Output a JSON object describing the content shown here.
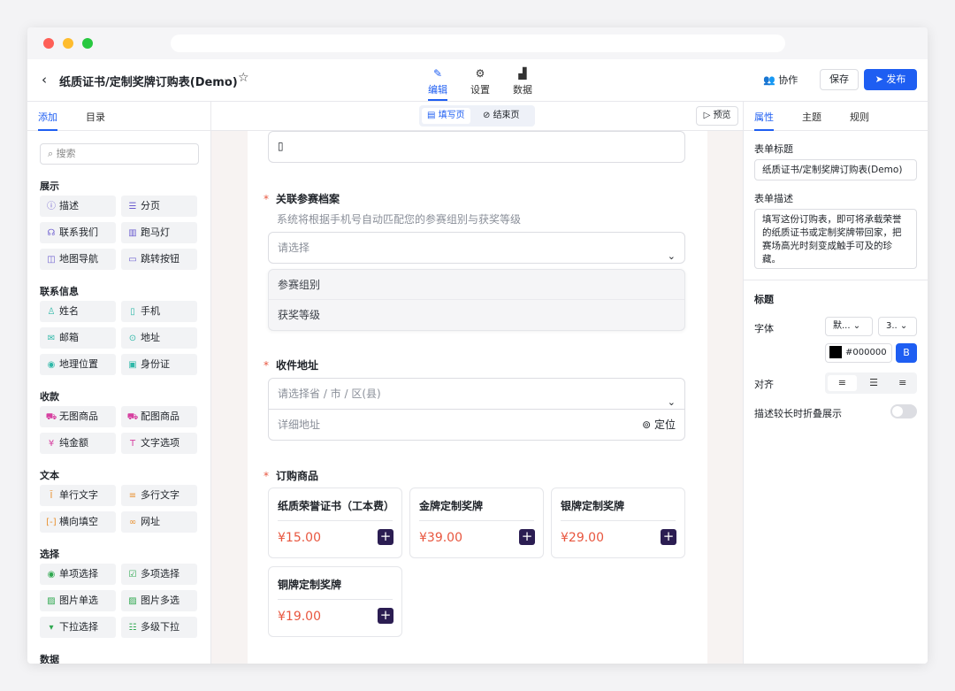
{
  "header": {
    "title": "纸质证书/定制奖牌订购表(Demo)",
    "nav_tabs": [
      {
        "label": "编辑",
        "icon": "pencil-icon"
      },
      {
        "label": "设置",
        "icon": "gear-icon"
      },
      {
        "label": "数据",
        "icon": "chart-icon"
      }
    ],
    "collab_label": "协作",
    "save_label": "保存",
    "publish_label": "发布"
  },
  "left_panel": {
    "tabs": [
      "添加",
      "目录"
    ],
    "search_placeholder": "搜索",
    "groups": [
      {
        "title": "展示",
        "items": [
          "描述",
          "分页",
          "联系我们",
          "跑马灯",
          "地图导航",
          "跳转按钮"
        ]
      },
      {
        "title": "联系信息",
        "items": [
          "姓名",
          "手机",
          "邮箱",
          "地址",
          "地理位置",
          "身份证"
        ]
      },
      {
        "title": "收款",
        "items": [
          "无图商品",
          "配图商品",
          "纯金额",
          "文字选项"
        ]
      },
      {
        "title": "文本",
        "items": [
          "单行文字",
          "多行文字",
          "横向填空",
          "网址"
        ]
      },
      {
        "title": "选择",
        "items": [
          "单项选择",
          "多项选择",
          "图片单选",
          "图片多选",
          "下拉选择",
          "多级下拉"
        ]
      },
      {
        "title": "数据",
        "items": []
      }
    ]
  },
  "canvas": {
    "page_switch": [
      "填写页",
      "结束页"
    ],
    "preview_label": "预览",
    "fields": {
      "archive": {
        "title": "关联参赛档案",
        "description": "系统将根据手机号自动匹配您的参赛组别与获奖等级",
        "placeholder": "请选择",
        "options": [
          "参赛组别",
          "获奖等级"
        ]
      },
      "address": {
        "title": "收件地址",
        "region_placeholder": "请选择省 / 市 / 区(县)",
        "detail_placeholder": "详细地址",
        "locate_label": "定位"
      },
      "products": {
        "title": "订购商品",
        "items": [
          {
            "name": "纸质荣誉证书（工本费）",
            "price": "¥15.00"
          },
          {
            "name": "金牌定制奖牌",
            "price": "¥39.00"
          },
          {
            "name": "银牌定制奖牌",
            "price": "¥29.00"
          },
          {
            "name": "铜牌定制奖牌",
            "price": "¥19.00"
          }
        ]
      }
    }
  },
  "right_panel": {
    "tabs": [
      "属性",
      "主题",
      "规则"
    ],
    "form_title_label": "表单标题",
    "form_title_value": "纸质证书/定制奖牌订购表(Demo)",
    "form_desc_label": "表单描述",
    "form_desc_value": "填写这份订购表，即可将承载荣誉的纸质证书或定制奖牌带回家，把赛场高光时刻变成触手可及的珍藏。",
    "heading_label": "标题",
    "font_label": "字体",
    "font_family_value": "默...",
    "font_size_value": "3..",
    "color_value": "#000000",
    "bold_label": "B",
    "align_label": "对齐",
    "collapse_label": "描述较长时折叠展示"
  },
  "colors": {
    "accent": "#1e5ef2",
    "price": "#e8563f",
    "add_button": "#2b1d52",
    "required": "#e8563f"
  }
}
